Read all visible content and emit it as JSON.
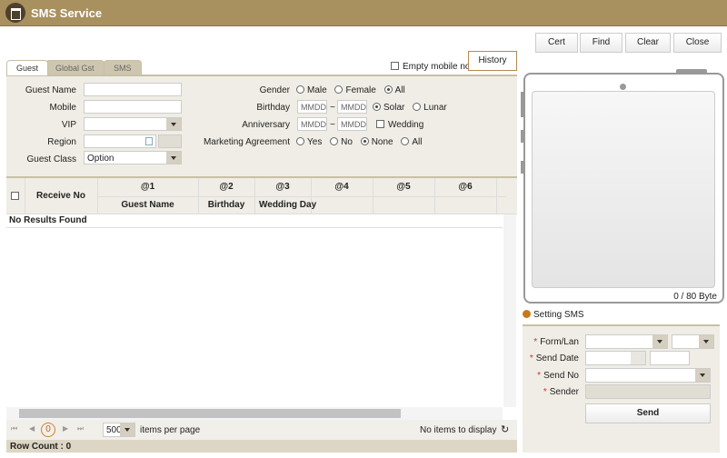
{
  "title": "SMS Service",
  "tabs": [
    "Guest",
    "Global Gst",
    "SMS"
  ],
  "empty_mobile_label": "Empty mobile no",
  "history_label": "History",
  "filters": {
    "guest_name": "Guest Name",
    "mobile": "Mobile",
    "vip": "VIP",
    "region": "Region",
    "guest_class": "Guest Class",
    "guest_class_value": "Option",
    "gender": "Gender",
    "gender_options": [
      "Male",
      "Female",
      "All"
    ],
    "birthday": "Birthday",
    "anniversary": "Anniversary",
    "mmdd": "MMDD",
    "tilde": "~",
    "calendar_options": [
      "Solar",
      "Lunar"
    ],
    "wedding": "Wedding",
    "marketing": "Marketing Agreement",
    "marketing_options": [
      "Yes",
      "No",
      "None",
      "All"
    ]
  },
  "grid": {
    "receive_no": "Receive No",
    "slots": [
      "@1",
      "@2",
      "@3",
      "@4",
      "@5",
      "@6"
    ],
    "sub": [
      "Guest Name",
      "Birthday",
      "Wedding Day"
    ],
    "empty": "No Results Found"
  },
  "pager": {
    "page": "0",
    "page_size": "500",
    "per_page": "items per page",
    "status": "No items to display",
    "row_count": "Row Count : 0"
  },
  "buttons": {
    "cert": "Cert",
    "find": "Find",
    "clear": "Clear",
    "close": "Close"
  },
  "phone": {
    "bytes": "0  / 80 Byte"
  },
  "setting": {
    "title": "Setting SMS",
    "form_lan": "Form/Lan",
    "send_date": "Send Date",
    "send_no": "Send No",
    "sender": "Sender",
    "send": "Send",
    "required": "*"
  }
}
